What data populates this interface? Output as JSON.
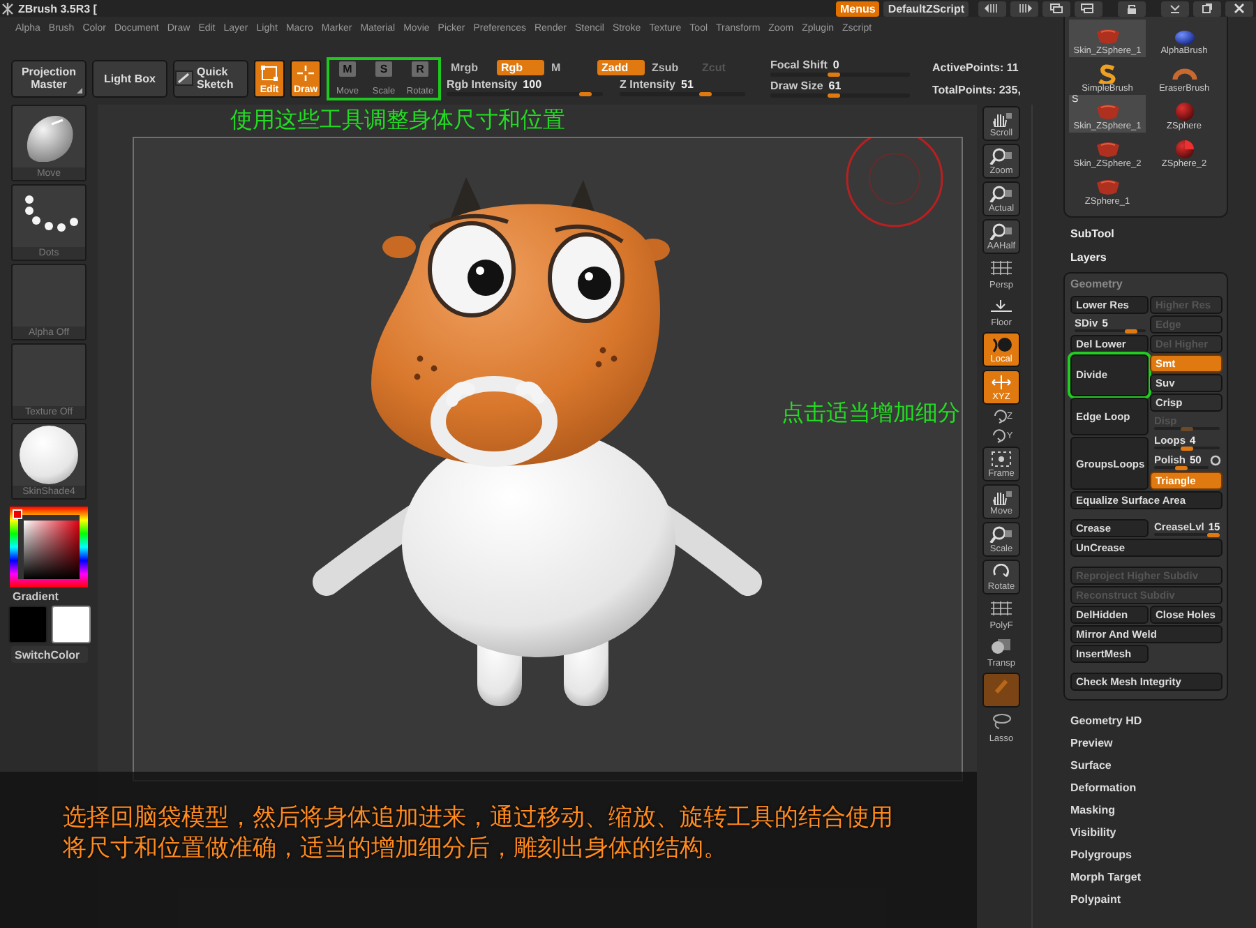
{
  "window": {
    "title": "ZBrush 3.5R3 ["
  },
  "title_bar": {
    "menus": {
      "label": "Menus",
      "on": true
    },
    "script": "DefaultZScript"
  },
  "menu_bar": [
    "Alpha",
    "Brush",
    "Color",
    "Document",
    "Draw",
    "Edit",
    "Layer",
    "Light",
    "Macro",
    "Marker",
    "Material",
    "Movie",
    "Picker",
    "Preferences",
    "Render",
    "Stencil",
    "Stroke",
    "Texture",
    "Tool",
    "Transform",
    "Zoom",
    "Zplugin",
    "Zscript"
  ],
  "toolbar": {
    "shelf_buttons": [
      {
        "label": "Projection Master",
        "kind": "menu"
      },
      {
        "label": "Light Box",
        "kind": "plain"
      },
      {
        "label": "Quick Sketch",
        "kind": "sketch"
      }
    ],
    "mode_buttons": [
      {
        "label": "Edit",
        "kind": "edit",
        "on": true
      },
      {
        "label": "Draw",
        "kind": "draw",
        "on": true
      }
    ],
    "transform_group": {
      "highlighted": true,
      "buttons": [
        {
          "label": "Move",
          "letter": "M",
          "on": false
        },
        {
          "label": "Scale",
          "letter": "S",
          "on": false
        },
        {
          "label": "Rotate",
          "letter": "R",
          "on": false
        }
      ]
    },
    "color_modes": [
      {
        "label": "Mrgb",
        "selected": false,
        "disabled": false
      },
      {
        "label": "Rgb",
        "selected": true,
        "disabled": false
      },
      {
        "label": "M",
        "selected": false,
        "disabled": false
      },
      {
        "label": "Zadd",
        "selected": true,
        "disabled": false
      },
      {
        "label": "Zsub",
        "selected": false,
        "disabled": false
      },
      {
        "label": "Zcut",
        "selected": false,
        "disabled": true
      }
    ],
    "intensity_sliders": [
      {
        "label": "Rgb Intensity",
        "value": "100",
        "level": 0.92
      },
      {
        "label": "Z Intensity",
        "value": "51",
        "level": 0.7
      }
    ],
    "draw_sliders": [
      {
        "label": "Focal Shift",
        "value": "0",
        "level": 0.45
      },
      {
        "label": "Draw Size",
        "value": "61",
        "level": 0.45
      }
    ],
    "stats": [
      "ActivePoints: 11",
      "TotalPoints: 235,"
    ]
  },
  "annotations": [
    {
      "kind": "top",
      "text": "使用这些工具调整身体尺寸和位置"
    },
    {
      "kind": "side",
      "text": "点击适当增加细分"
    }
  ],
  "left_shelf": {
    "tiles": [
      {
        "kind": "brush",
        "label": "Move"
      },
      {
        "kind": "stroke",
        "label": "Dots"
      },
      {
        "kind": "alpha",
        "label": "Alpha Off"
      },
      {
        "kind": "texture",
        "label": "Texture Off"
      },
      {
        "kind": "material",
        "label": "SkinShade4"
      }
    ],
    "gradient_label": "Gradient",
    "switch_label": "SwitchColor"
  },
  "view_controls": [
    {
      "kind": "scroll",
      "label": "Scroll",
      "on": false
    },
    {
      "kind": "zoom",
      "label": "Zoom",
      "on": false
    },
    {
      "kind": "actual",
      "label": "Actual",
      "on": false
    },
    {
      "kind": "aahalf",
      "label": "AAHalf",
      "on": false
    },
    {
      "kind": "persp",
      "label": "Persp",
      "on": false
    },
    {
      "kind": "floor",
      "label": "Floor",
      "on": false
    },
    {
      "kind": "local",
      "label": "Local",
      "on": true
    },
    {
      "kind": "xyz",
      "label": "XYZ",
      "on": true
    },
    {
      "kind": "spin",
      "label": "Z",
      "on": false
    },
    {
      "kind": "spin",
      "label": "Y",
      "on": false
    },
    {
      "kind": "frame",
      "label": "Frame",
      "on": false
    },
    {
      "kind": "move",
      "label": "Move",
      "on": false
    },
    {
      "kind": "scale",
      "label": "Scale",
      "on": false
    },
    {
      "kind": "rotate",
      "label": "Rotate",
      "on": false
    },
    {
      "kind": "polyf",
      "label": "PolyF",
      "on": false
    },
    {
      "kind": "transp",
      "label": "Transp",
      "on": false
    },
    {
      "kind": "solo",
      "on": true
    },
    {
      "kind": "lasso",
      "label": "Lasso",
      "on": false
    }
  ],
  "tool_palette": [
    {
      "kind": "skin",
      "label": "Skin_ZSphere_1",
      "selected": true
    },
    {
      "kind": "alpha",
      "label": "AlphaBrush",
      "selected": false
    },
    {
      "kind": "simple",
      "label": "SimpleBrush",
      "selected": false
    },
    {
      "kind": "eraser",
      "label": "EraserBrush",
      "selected": false
    },
    {
      "kind": "skin",
      "label": "Skin_ZSphere_1",
      "badge": "S",
      "selected": true
    },
    {
      "kind": "sphere",
      "label": "ZSphere",
      "selected": false
    },
    {
      "kind": "skin",
      "label": "Skin_ZSphere_2",
      "selected": false
    },
    {
      "kind": "sphere2",
      "label": "ZSphere_2",
      "selected": false
    },
    {
      "kind": "skin",
      "label": "ZSphere_1",
      "selected": false
    }
  ],
  "palette_sections": [
    "SubTool",
    "Layers"
  ],
  "geometry": {
    "title": "Geometry",
    "groups": [
      [
        {
          "kind": "row",
          "cells": [
            {
              "kind": "button",
              "label": "Lower Res",
              "disabled": false
            },
            {
              "kind": "button",
              "label": "Higher Res",
              "disabled": true
            }
          ]
        },
        {
          "kind": "row",
          "cells": [
            {
              "kind": "slider",
              "label": "SDiv",
              "value": "5",
              "level": 0.85,
              "disabled": false
            },
            {
              "kind": "button",
              "label": "Edge",
              "disabled": true
            }
          ]
        },
        {
          "kind": "row",
          "cells": [
            {
              "kind": "button",
              "label": "Del Lower",
              "disabled": false
            },
            {
              "kind": "button",
              "label": "Del Higher",
              "disabled": true
            }
          ]
        },
        {
          "kind": "split",
          "left": [
            {
              "kind": "button",
              "label": "Divide",
              "disabled": false,
              "highlighted": true
            },
            {
              "kind": "button",
              "label": "Edge Loop",
              "disabled": false
            },
            {
              "kind": "button",
              "label": "GroupsLoops",
              "disabled": false
            }
          ],
          "right": [
            {
              "kind": "toggle",
              "label": "Smt",
              "on": true,
              "disabled": false
            },
            {
              "kind": "toggle",
              "label": "Suv",
              "on": false,
              "disabled": false
            },
            {
              "kind": "toggle",
              "label": "Crisp",
              "on": false,
              "disabled": false
            },
            {
              "kind": "slider",
              "label": "Disp",
              "level": 0.5,
              "disabled": true
            },
            {
              "kind": "slider",
              "label": "Loops",
              "value": "4",
              "level": 0.5,
              "disabled": false
            },
            {
              "kind": "slider",
              "label": "Polish",
              "value": "50",
              "level": 0.5,
              "disabled": false,
              "circle": true
            },
            {
              "kind": "toggle",
              "label": "Triangle",
              "on": true,
              "disabled": false
            }
          ]
        },
        {
          "kind": "row",
          "cells": [
            {
              "kind": "button",
              "label": "Equalize Surface Area",
              "disabled": false,
              "wide": true
            }
          ]
        }
      ],
      [
        {
          "kind": "row",
          "cells": [
            {
              "kind": "button",
              "label": "Crease",
              "disabled": false
            },
            {
              "kind": "slider",
              "label": "CreaseLvl",
              "value": "15",
              "level": 1,
              "disabled": false
            }
          ]
        },
        {
          "kind": "row",
          "cells": [
            {
              "kind": "button",
              "label": "UnCrease",
              "disabled": false,
              "wide": true
            }
          ]
        }
      ],
      [
        {
          "kind": "row",
          "cells": [
            {
              "kind": "button",
              "label": "Reproject Higher Subdiv",
              "disabled": true,
              "wide": true
            }
          ]
        },
        {
          "kind": "row",
          "cells": [
            {
              "kind": "button",
              "label": "Reconstruct Subdiv",
              "disabled": true,
              "wide": true
            }
          ]
        },
        {
          "kind": "row",
          "cells": [
            {
              "kind": "button",
              "label": "DelHidden",
              "disabled": false
            },
            {
              "kind": "button",
              "label": "Close Holes",
              "disabled": false
            }
          ]
        },
        {
          "kind": "row",
          "cells": [
            {
              "kind": "button",
              "label": "Mirror And Weld",
              "disabled": false,
              "wide": true
            }
          ]
        },
        {
          "kind": "row",
          "cells": [
            {
              "kind": "button",
              "label": "InsertMesh",
              "disabled": false
            }
          ]
        }
      ],
      [
        {
          "kind": "row",
          "cells": [
            {
              "kind": "button",
              "label": "Check Mesh Integrity",
              "disabled": false,
              "wide": true
            }
          ]
        }
      ]
    ]
  },
  "more_sections": [
    "Geometry HD",
    "Preview",
    "Surface",
    "Deformation",
    "Masking",
    "Visibility",
    "Polygroups",
    "Morph Target",
    "Polypaint"
  ],
  "caption": [
    "选择回脑袋模型，然后将身体追加进来，通过移动、缩放、旋转工具的结合使用",
    "将尺寸和位置做准确，适当的增加细分后，雕刻出身体的结构。"
  ]
}
